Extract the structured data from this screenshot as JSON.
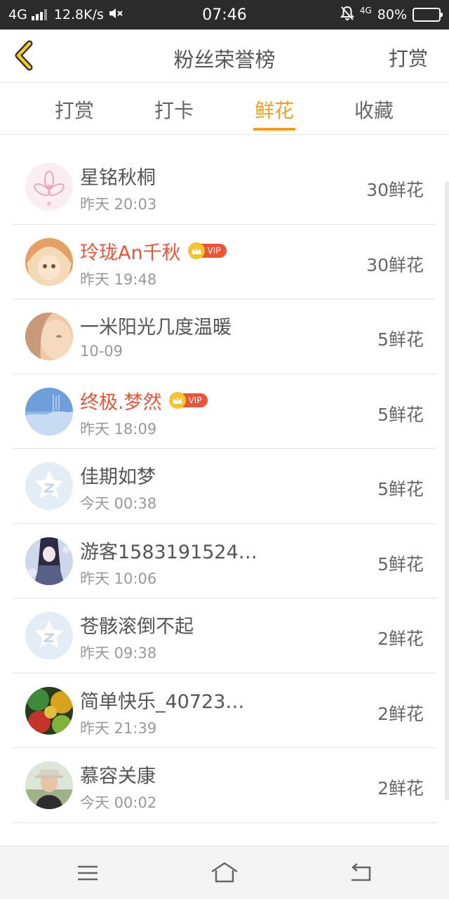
{
  "status_bar": {
    "network": "4G",
    "speed": "12.8K/s",
    "time": "07:46",
    "mobile_tag": "4G",
    "battery": "80%",
    "battery_level": 0.8
  },
  "header": {
    "title": "粉丝荣誉榜",
    "action_label": "打赏"
  },
  "tabs": [
    {
      "label": "打赏"
    },
    {
      "label": "打卡"
    },
    {
      "label": "鲜花"
    },
    {
      "label": "收藏"
    }
  ],
  "active_tab": 2,
  "vip_label": "VIP",
  "list": [
    {
      "name": "星铭秋桐",
      "time": "昨天 20:03",
      "amount": "30鲜花",
      "vip": false,
      "avatar": "flower-avatar"
    },
    {
      "name": "玲珑An千秋",
      "time": "昨天 19:48",
      "amount": "30鲜花",
      "vip": true,
      "avatar": "anime-girl-avatar"
    },
    {
      "name": "一米阳光几度温暖",
      "time": "10-09",
      "amount": "5鲜花",
      "vip": false,
      "avatar": "blurred-face-avatar"
    },
    {
      "name": "终极.梦然",
      "time": "昨天 18:09",
      "amount": "5鲜花",
      "vip": true,
      "avatar": "sky-avatar"
    },
    {
      "name": "佳期如梦",
      "time": "今天 00:38",
      "amount": "5鲜花",
      "vip": false,
      "avatar": "default-avatar"
    },
    {
      "name": "游客1583191524…",
      "time": "昨天 10:06",
      "amount": "5鲜花",
      "vip": false,
      "avatar": "anime-dark-avatar"
    },
    {
      "name": "苍骸滚倒不起",
      "time": "昨天 09:38",
      "amount": "2鲜花",
      "vip": false,
      "avatar": "default-avatar"
    },
    {
      "name": "简单快乐_40723…",
      "time": "昨天 21:39",
      "amount": "2鲜花",
      "vip": false,
      "avatar": "umbrella-avatar"
    },
    {
      "name": "慕容关康",
      "time": "今天 00:02",
      "amount": "2鲜花",
      "vip": false,
      "avatar": "man-hat-avatar"
    }
  ],
  "colors": {
    "accent": "#f0a020",
    "vip_red": "#e8553b",
    "status_bar_bg": "#2b2b2b"
  }
}
